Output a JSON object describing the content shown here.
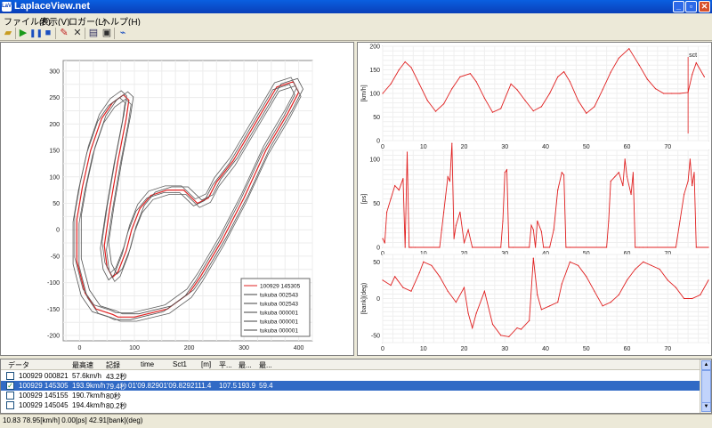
{
  "window": {
    "title": "LaplaceView.net",
    "icon_text": "LaV"
  },
  "menu": {
    "items": [
      "ファイル(F)",
      "表示(V)",
      "ロガー(L)",
      "ヘルプ(H)"
    ]
  },
  "toolbar": {
    "icons": [
      "open-folder-icon",
      "play-icon",
      "pause-icon",
      "stop-icon",
      "pen-icon",
      "delete-icon",
      "table-icon",
      "export-icon",
      "graph-icon"
    ]
  },
  "map": {
    "x_ticks": [
      "0",
      "100",
      "200",
      "300",
      "400"
    ],
    "y_ticks": [
      "300",
      "250",
      "200",
      "150",
      "100",
      "50",
      "0",
      "-50",
      "-100",
      "-150",
      "-200"
    ],
    "legend": [
      {
        "label": "100929 145305",
        "color": "#e02020"
      },
      {
        "label": "tukuba 002543",
        "color": "#404040"
      },
      {
        "label": "tukuba 002543",
        "color": "#404040"
      },
      {
        "label": "tukuba 000001",
        "color": "#404040"
      },
      {
        "label": "tukuba 000001",
        "color": "#404040"
      },
      {
        "label": "tukuba 000001",
        "color": "#404040"
      }
    ]
  },
  "chart_data": [
    {
      "type": "line",
      "ylabel": "[km/h]",
      "ylim": [
        0,
        200
      ],
      "xlim": [
        0,
        80
      ],
      "x_ticks": [
        "0",
        "10",
        "20",
        "30",
        "40",
        "50",
        "60",
        "70"
      ],
      "y_ticks": [
        "200",
        "150",
        "100",
        "50",
        "0"
      ],
      "annotation": "sct",
      "marker_x": 75,
      "x": [
        0,
        2,
        4,
        5.5,
        7,
        9,
        11,
        13,
        15,
        17,
        19,
        21.5,
        23,
        25,
        27,
        29,
        31.5,
        33,
        35,
        37,
        39,
        41,
        43,
        44.5,
        46,
        48,
        50,
        52,
        54,
        56,
        58,
        60.5,
        63,
        65,
        67,
        69,
        71,
        73,
        75,
        76,
        77,
        79
      ],
      "series": [
        {
          "values": [
            100,
            120,
            150,
            167,
            155,
            120,
            85,
            62,
            78,
            110,
            135,
            142,
            125,
            90,
            60,
            68,
            120,
            108,
            85,
            63,
            72,
            100,
            135,
            146,
            125,
            85,
            58,
            72,
            108,
            145,
            175,
            195,
            160,
            130,
            110,
            100,
            100,
            100,
            102,
            140,
            165,
            135
          ]
        }
      ]
    },
    {
      "type": "line",
      "ylabel": "[ps]",
      "ylim": [
        0,
        110
      ],
      "xlim": [
        0,
        80
      ],
      "x_ticks": [
        "0",
        "10",
        "20",
        "30",
        "40",
        "50",
        "60",
        "70"
      ],
      "y_ticks": [
        "100",
        "50",
        "0"
      ],
      "x": [
        0,
        0.5,
        1,
        2,
        3,
        4,
        5,
        5.5,
        6,
        6.5,
        7,
        8,
        14,
        14.5,
        15,
        16,
        16.5,
        17,
        17.5,
        18,
        19,
        20,
        21,
        22,
        29,
        29.5,
        30,
        30.5,
        31,
        32,
        36,
        36.5,
        37,
        37.5,
        38,
        39,
        39.5,
        40,
        41,
        42,
        43,
        44,
        44.5,
        45,
        46,
        55,
        55.5,
        56,
        57,
        58,
        59,
        59.5,
        60,
        61,
        61.5,
        62,
        63,
        64,
        65,
        72,
        73,
        74,
        75,
        75.5,
        76,
        76.5,
        77,
        80
      ],
      "series": [
        {
          "values": [
            10,
            5,
            40,
            55,
            70,
            65,
            78,
            0,
            108,
            0,
            0,
            0,
            0,
            20,
            40,
            80,
            75,
            118,
            10,
            25,
            40,
            5,
            20,
            0,
            0,
            30,
            85,
            88,
            0,
            0,
            0,
            25,
            20,
            0,
            30,
            18,
            0,
            0,
            0,
            20,
            65,
            85,
            82,
            0,
            0,
            0,
            30,
            75,
            80,
            85,
            70,
            100,
            80,
            60,
            85,
            0,
            0,
            0,
            0,
            0,
            30,
            60,
            75,
            100,
            70,
            85,
            0,
            0
          ]
        }
      ]
    },
    {
      "type": "line",
      "ylabel": "[bank](deg)",
      "ylim": [
        -60,
        60
      ],
      "xlim": [
        0,
        80
      ],
      "x_ticks": [
        "0",
        "10",
        "20",
        "30",
        "40",
        "50",
        "60",
        "70"
      ],
      "y_ticks": [
        "50",
        "0",
        "-50"
      ],
      "x": [
        0,
        2,
        3,
        5,
        7,
        9,
        10,
        12,
        14,
        16,
        18,
        20,
        21,
        22,
        23,
        25,
        27,
        29,
        31,
        33,
        34,
        36,
        37,
        38,
        39,
        41,
        43,
        44,
        46,
        48,
        50,
        52,
        54,
        56,
        58,
        60,
        62,
        64,
        66,
        68,
        70,
        72,
        74,
        76,
        78,
        80
      ],
      "series": [
        {
          "values": [
            25,
            18,
            30,
            15,
            10,
            35,
            50,
            45,
            30,
            10,
            -5,
            15,
            -20,
            -40,
            -20,
            10,
            -35,
            -50,
            -52,
            -40,
            -42,
            -30,
            55,
            5,
            -15,
            -10,
            -5,
            20,
            50,
            45,
            30,
            10,
            -10,
            -5,
            5,
            25,
            40,
            50,
            45,
            40,
            25,
            15,
            0,
            0,
            5,
            25
          ]
        }
      ]
    }
  ],
  "table": {
    "headers": [
      "データ",
      "最高速",
      "記録",
      "time",
      "Sct1",
      "[m]",
      "平...",
      "最...",
      "最..."
    ],
    "rows": [
      {
        "checked": false,
        "cells": [
          "100929 000821",
          "57.6km/h",
          "43.2秒",
          "",
          "",
          "",
          "",
          "",
          ""
        ]
      },
      {
        "checked": true,
        "selected": true,
        "cells": [
          "100929 145305",
          "193.9km/h",
          "79.4秒",
          "01'09.829",
          "01'09.829",
          "2111.4",
          "107.5",
          "193.9",
          "59.4"
        ]
      },
      {
        "checked": false,
        "cells": [
          "100929 145155",
          "190.7km/h",
          "80秒",
          "",
          "",
          "",
          "",
          "",
          ""
        ]
      },
      {
        "checked": false,
        "cells": [
          "100929 145045",
          "194.4km/h",
          "80.2秒",
          "",
          "",
          "",
          "",
          "",
          ""
        ]
      }
    ]
  },
  "status": {
    "text": "10.83  78.95[km/h]  0.00[ps]  42.91[bank](deg)"
  }
}
